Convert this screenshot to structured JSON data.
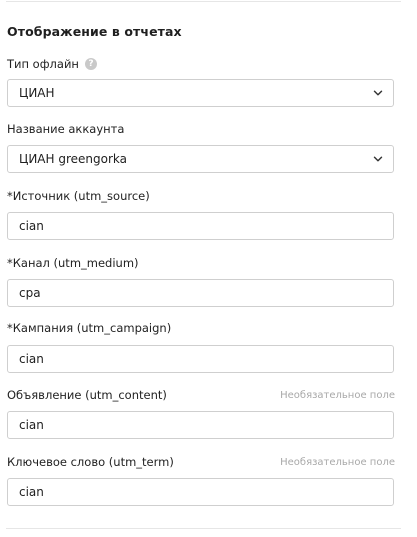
{
  "section": {
    "title": "Отображение в отчетах"
  },
  "fields": [
    {
      "label": "Тип офлайн",
      "value": "ЦИАН",
      "type": "select",
      "help_icon": "question-icon"
    },
    {
      "label": "Название аккаунта",
      "value": "ЦИАН greengorka",
      "type": "select"
    },
    {
      "label": "*Источник (utm_source)",
      "value": "cian",
      "type": "text"
    },
    {
      "label": "*Канал (utm_medium)",
      "value": "cpa",
      "type": "text"
    },
    {
      "label": "*Кампания (utm_campaign)",
      "value": "cian",
      "type": "text"
    },
    {
      "label": "Объявление (utm_content)",
      "value": "cian",
      "type": "text",
      "optional_note": "Необязательное поле"
    },
    {
      "label": "Ключевое слово (utm_term)",
      "value": "cian",
      "type": "text",
      "optional_note": "Необязательное поле"
    }
  ],
  "icons": {
    "help": "question-icon",
    "dropdown": "chevron-down-icon"
  },
  "help_glyph": "?"
}
